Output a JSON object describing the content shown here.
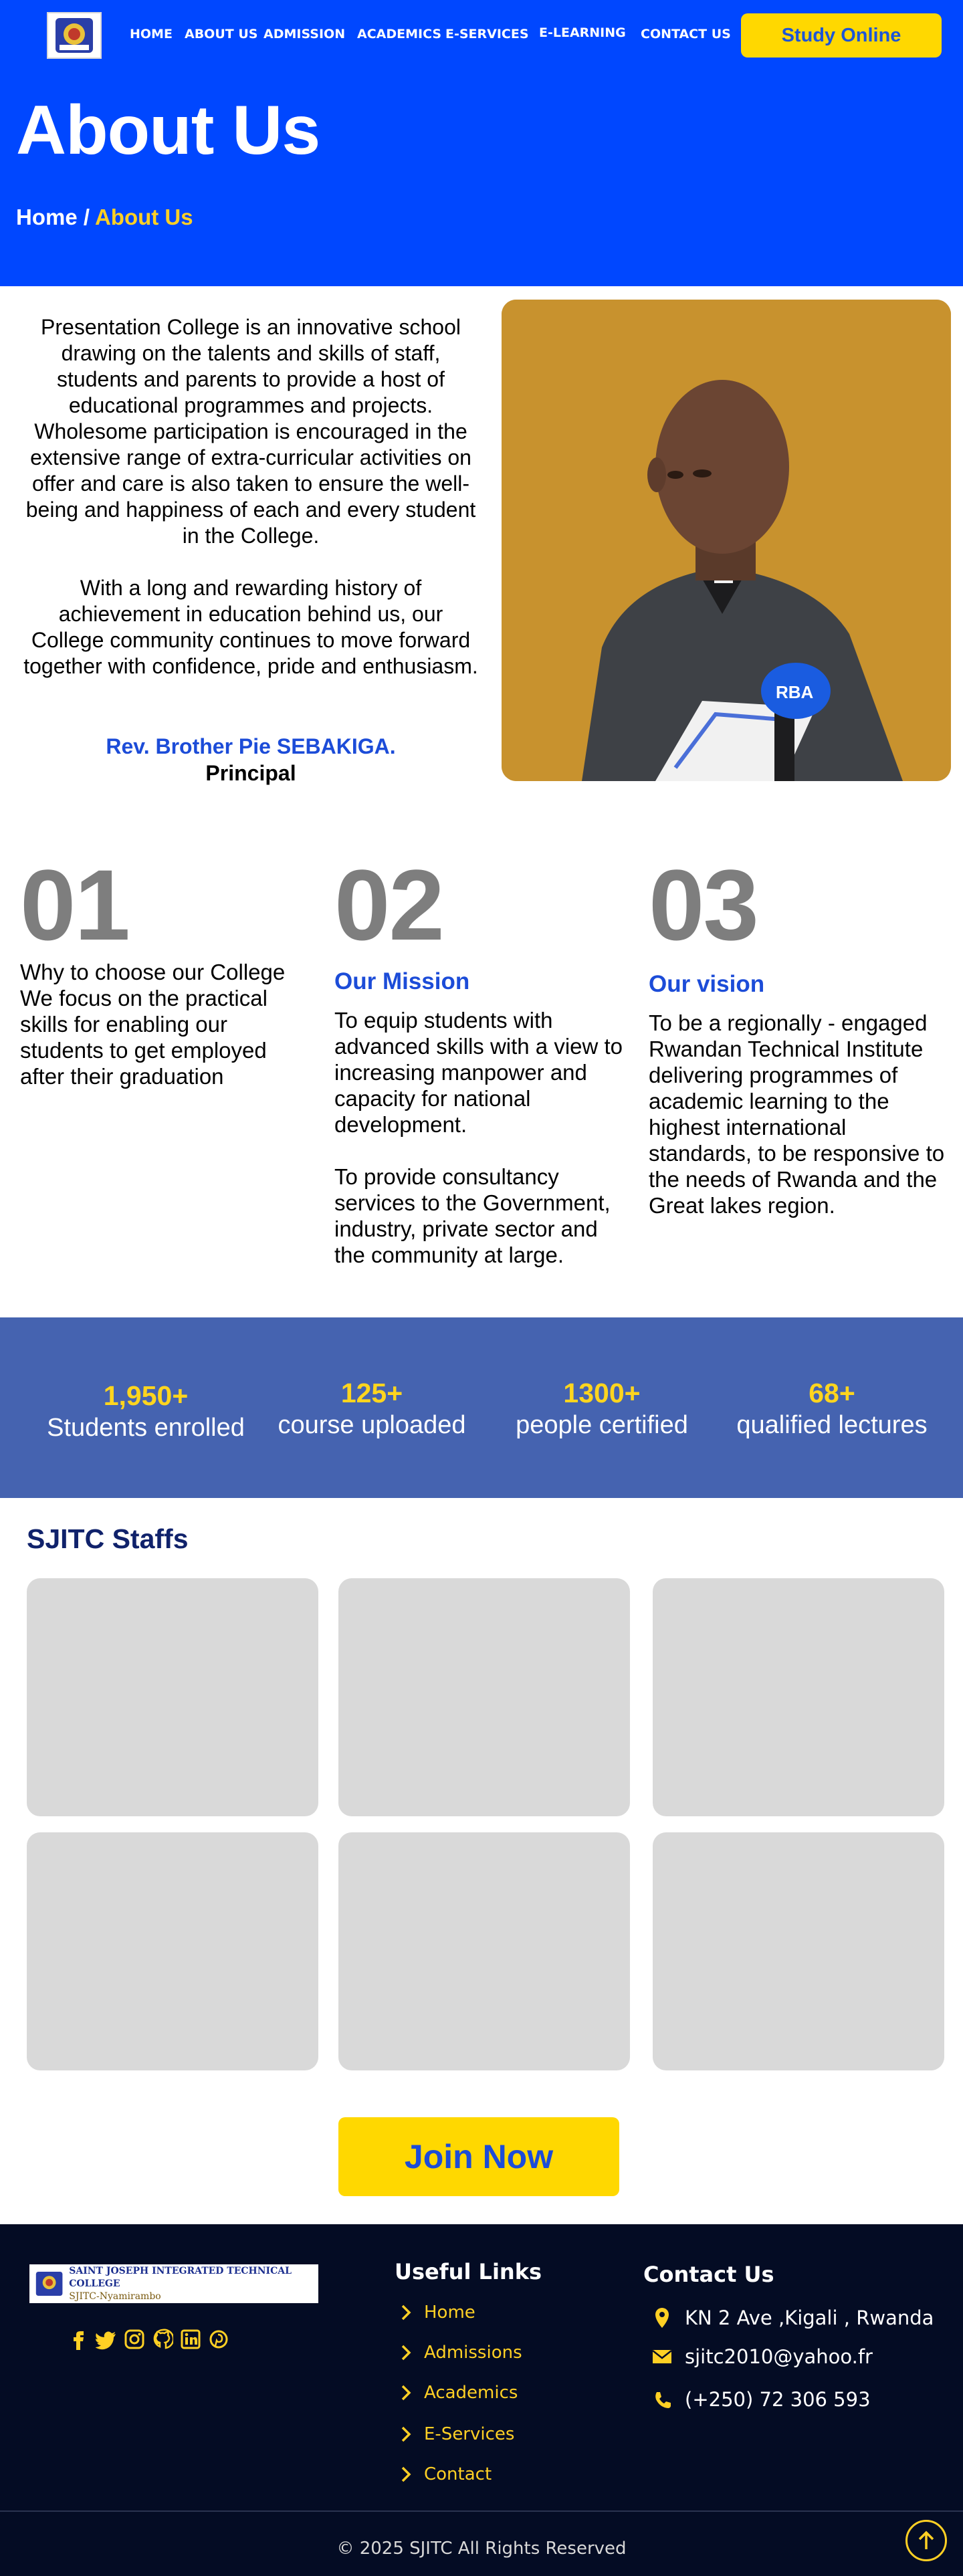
{
  "nav": {
    "items": [
      "HOME",
      "ABOUT US",
      "ADMISSION",
      "ACADEMICS",
      "E-SERVICES",
      "E-LEARNING",
      "CONTACT US"
    ],
    "cta": "Study Online",
    "bg_color": "#0047ff",
    "cta_color": "#ffd800"
  },
  "hero": {
    "title": "About Us",
    "breadcrumb_home": "Home",
    "breadcrumb_sep": " / ",
    "breadcrumb_current": "About Us"
  },
  "intro": {
    "p1": "Presentation College is an innovative school drawing on the talents and skills of staff, students and parents to provide a host of educational programmes and projects. Wholesome participation is encouraged in the extensive range of extra-curricular activities on offer and care is also taken to ensure the well-being and happiness of each and every student in the College.",
    "p2": "With a long and rewarding history of achievement in education behind us, our College community continues to move forward together with confidence, pride and enthusiasm.",
    "signature_name": "Rev. Brother Pie SEBAKIGA.",
    "signature_role": "Principal"
  },
  "columns": [
    {
      "number": "01",
      "heading": "",
      "text": "Why to choose our College We focus on the practical skills for enabling our students to get employed after their graduation"
    },
    {
      "number": "02",
      "heading": "Our Mission",
      "text1": "To equip students with advanced skills with a view to increasing manpower and capacity for national development.",
      "text2": "To provide consultancy services to the Government, industry, private sector and the community at large."
    },
    {
      "number": "03",
      "heading": "Our vision",
      "text": "To be a regionally - engaged Rwandan Technical Institute delivering programmes of academic learning to the highest international standards, to be responsive to the needs of Rwanda and the Great lakes region."
    }
  ],
  "stats": [
    {
      "value": "1,950+",
      "label": "Students enrolled"
    },
    {
      "value": "125+",
      "label": "course uploaded"
    },
    {
      "value": "1300+",
      "label": "people certified"
    },
    {
      "value": "68+",
      "label": "qualified lectures"
    }
  ],
  "staff": {
    "title": "SJITC Staffs",
    "card_count": 6
  },
  "join": "Join Now",
  "footer": {
    "logo_line1": "SAINT JOSEPH INTEGRATED TECHNICAL COLLEGE",
    "logo_line2": "SJITC-Nyamirambo",
    "socials": [
      "facebook-icon",
      "twitter-icon",
      "instagram-icon",
      "github-icon",
      "linkedin-icon",
      "pinterest-icon"
    ],
    "useful_links_title": "Useful Links",
    "links": [
      "Home",
      "Admissions",
      "Academics",
      "E-Services",
      "Contact"
    ],
    "contact_title": "Contact Us",
    "address": "KN 2 Ave ,Kigali , Rwanda",
    "email": "sjitc2010@yahoo.fr",
    "phone": "(+250) 72 306 593",
    "copyright": "© 2025 SJITC All Rights Reserved"
  }
}
